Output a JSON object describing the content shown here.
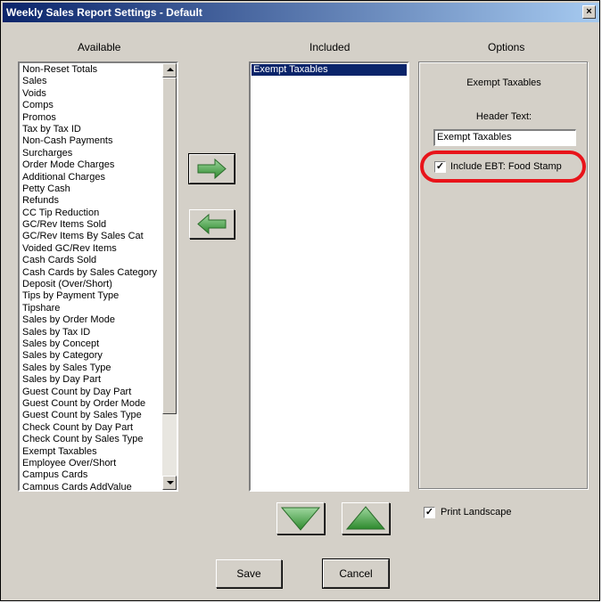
{
  "window": {
    "title": "Weekly Sales Report Settings - Default",
    "close_glyph": "×"
  },
  "columns": {
    "available_label": "Available",
    "included_label": "Included",
    "options_label": "Options"
  },
  "available_items": [
    "Non-Reset Totals",
    "Sales",
    "Voids",
    "Comps",
    "Promos",
    "Tax by Tax ID",
    "Non-Cash Payments",
    "Surcharges",
    "Order Mode Charges",
    "Additional Charges",
    "Petty Cash",
    "Refunds",
    "CC Tip Reduction",
    "GC/Rev Items Sold",
    "GC/Rev Items By Sales Cat",
    "Voided GC/Rev Items",
    "Cash Cards Sold",
    "Cash Cards by Sales Category",
    "Deposit (Over/Short)",
    "Tips by Payment Type",
    "Tipshare",
    "Sales by Order Mode",
    "Sales by Tax ID",
    "Sales by Concept",
    "Sales by Category",
    "Sales by Sales Type",
    "Sales by Day Part",
    "Guest Count by Day Part",
    "Guest Count by Order Mode",
    "Guest Count by Sales Type",
    "Check Count by Day Part",
    "Check Count by Sales Type",
    "Exempt Taxables",
    "Employee Over/Short",
    "Campus Cards",
    "Campus Cards AddValue"
  ],
  "included_items": [
    "Exempt Taxables"
  ],
  "options": {
    "selected_item_title": "Exempt Taxables",
    "header_text_label": "Header Text:",
    "header_text_value": "Exempt Taxables",
    "include_ebt_label": "Include EBT: Food Stamp",
    "include_ebt_checked": true
  },
  "print_landscape": {
    "label": "Print Landscape",
    "checked": true
  },
  "buttons": {
    "save_label": "Save",
    "cancel_label": "Cancel"
  },
  "icons": {
    "add": "arrow-right-icon",
    "remove": "arrow-left-icon",
    "move_down": "arrow-down-icon",
    "move_up": "arrow-up-icon"
  },
  "colors": {
    "arrow_green": "#3f9d3f",
    "highlight_red": "#e8141a",
    "selection_blue": "#0a246a"
  }
}
